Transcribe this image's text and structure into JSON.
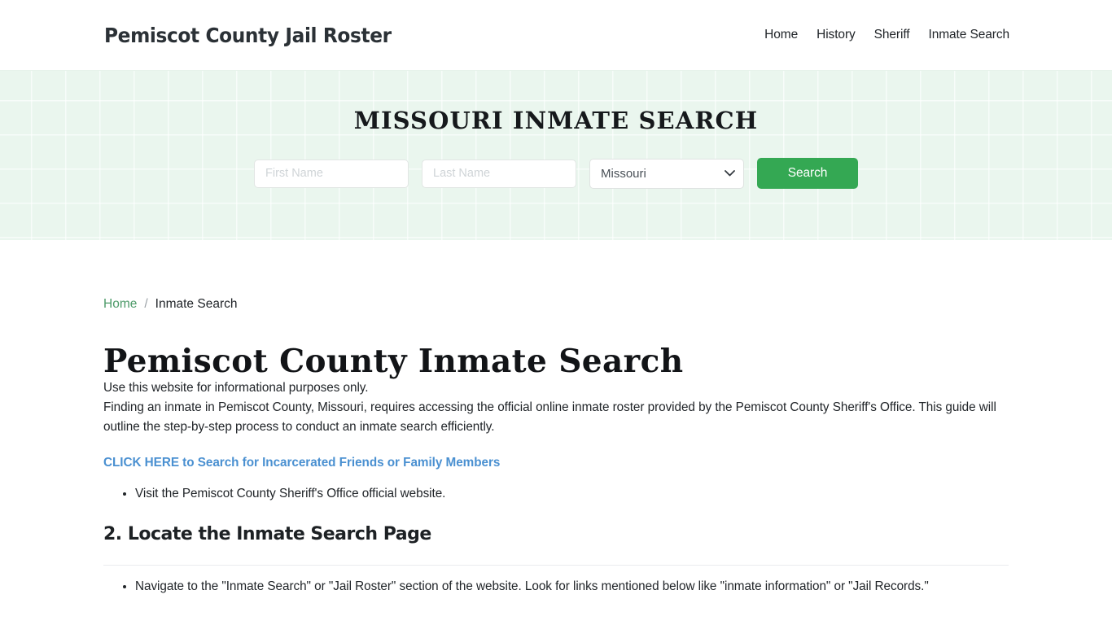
{
  "navbar": {
    "brand": "Pemiscot County Jail Roster",
    "links": [
      {
        "label": "Home"
      },
      {
        "label": "History"
      },
      {
        "label": "Sheriff"
      },
      {
        "label": "Inmate Search"
      }
    ]
  },
  "hero": {
    "title": "MISSOURI INMATE SEARCH",
    "background_color": "#eaf6ee",
    "form": {
      "first_name_placeholder": "First Name",
      "first_name_value": "",
      "last_name_placeholder": "Last Name",
      "last_name_value": "",
      "state_selected": "Missouri",
      "state_options": [
        "Missouri"
      ],
      "submit_label": "Search",
      "submit_color": "#34a853",
      "chevron_icon": "chevron-down-icon"
    }
  },
  "breadcrumb": {
    "home_label": "Home",
    "separator": "/",
    "current_label": "Inmate Search",
    "link_color": "#4c9a68"
  },
  "main": {
    "page_title": "Pemiscot County Inmate Search",
    "lead_paragraph": "Use this website for informational purposes only.",
    "intro_paragraph": "Finding an inmate in Pemiscot County, Missouri, requires accessing the official online inmate roster provided by the Pemiscot County Sheriff's Office. This guide will outline the step-by-step process to conduct an inmate search efficiently.",
    "cta_link": "CLICK HERE to Search for Incarcerated Friends or Family Members",
    "cta_color": "#4a90d1",
    "steps_one": [
      "Visit the Pemiscot County Sheriff's Office official website."
    ],
    "section_heading": "2. Locate the Inmate Search Page",
    "steps_two": [
      "Navigate to the \"Inmate Search\" or \"Jail Roster\" section of the website. Look for links mentioned below like \"inmate information\" or \"Jail Records.\""
    ]
  }
}
